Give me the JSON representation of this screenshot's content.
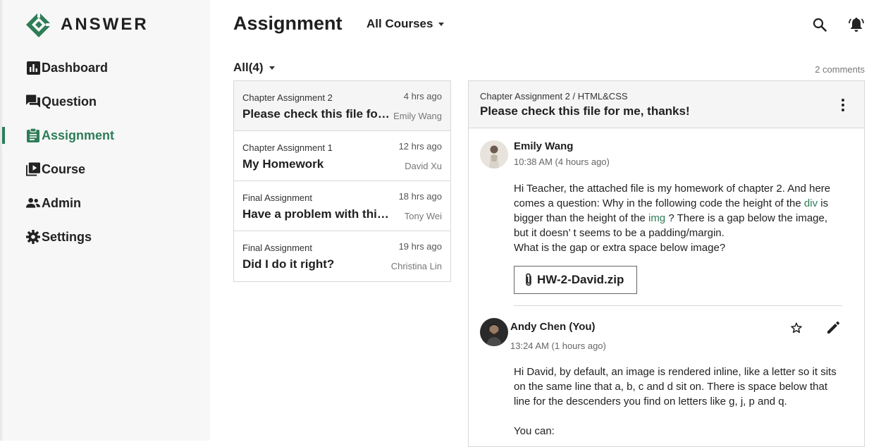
{
  "app": {
    "logo_text": "ANSWER"
  },
  "sidebar": {
    "items": [
      {
        "label": "Dashboard",
        "icon": "bar-chart-icon"
      },
      {
        "label": "Question",
        "icon": "forum-icon"
      },
      {
        "label": "Assignment",
        "icon": "clipboard-icon",
        "active": true
      },
      {
        "label": "Course",
        "icon": "video-library-icon"
      },
      {
        "label": "Admin",
        "icon": "people-icon"
      },
      {
        "label": "Settings",
        "icon": "gear-icon"
      }
    ]
  },
  "header": {
    "title": "Assignment",
    "course_filter": "All Courses",
    "icons": [
      "search-icon",
      "notification-bell-icon"
    ]
  },
  "filter": {
    "label": "All(4)",
    "comments": "2 comments"
  },
  "assignments": [
    {
      "category": "Chapter Assignment 2",
      "time": "4 hrs ago",
      "title": "Please check this file for me, thanks!",
      "author": "Emily Wang"
    },
    {
      "category": "Chapter Assignment 1",
      "time": "12 hrs ago",
      "title": "My Homework",
      "author": "David Xu"
    },
    {
      "category": "Final Assignment",
      "time": "18 hrs ago",
      "title": "Have a problem with this question",
      "author": "Tony Wei"
    },
    {
      "category": "Final Assignment",
      "time": "19 hrs ago",
      "title": "Did I do it right?",
      "author": "Christina Lin"
    }
  ],
  "detail": {
    "breadcrumb": "Chapter Assignment 2 / HTML&CSS",
    "title": "Please check this file for me, thanks!",
    "post": {
      "author": "Emily Wang",
      "time": "10:38 AM (4 hours ago)",
      "body_1": "Hi Teacher, the attached file is my homework of chapter 2. And here comes a question: Why in the following code the height of the ",
      "code_1": "div",
      "body_2": " is bigger than the height of the ",
      "code_2": "img",
      "body_3": " ? There is a gap below the image, but it doesn’ t seems to be a padding/margin.",
      "body_4": "What is the gap or extra space below image?",
      "attachment": "HW-2-David.zip"
    },
    "reply": {
      "author": "Andy Chen (You)",
      "time": "13:24 AM (1 hours ago)",
      "body_1": "Hi David, by default, an image is rendered inline, like a letter so it sits on the same line that a, b, c and d sit on. There is space below that line for the descenders you find on letters like g, j, p and q.",
      "body_2": "You can:"
    }
  },
  "colors": {
    "accent": "#2e7d57",
    "sidebar_bg": "#f7f7f7",
    "border": "#d8d8d8"
  }
}
